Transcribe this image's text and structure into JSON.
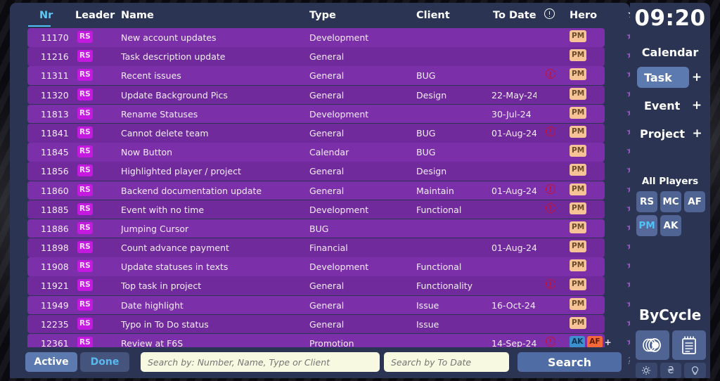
{
  "table": {
    "columns": {
      "nr": "Nr",
      "leader": "Leader",
      "name": "Name",
      "type": "Type",
      "client": "Client",
      "to_date": "To Date",
      "alert": "alert-circle-icon",
      "hero": "Hero",
      "star": "star-icon"
    },
    "sorted_by": "Nr",
    "rows": [
      {
        "nr": "11170",
        "leader": "RS",
        "name": "New account updates",
        "type": "Development",
        "client": "",
        "to_date": "",
        "alert": false,
        "heroes": [
          {
            "code": "PM",
            "style": "pm"
          }
        ],
        "plus": false
      },
      {
        "nr": "11216",
        "leader": "RS",
        "name": "Task description update",
        "type": "General",
        "client": "",
        "to_date": "",
        "alert": false,
        "heroes": [
          {
            "code": "PM",
            "style": "pm"
          }
        ],
        "plus": false
      },
      {
        "nr": "11311",
        "leader": "RS",
        "name": "Recent issues",
        "type": "General",
        "client": "BUG",
        "to_date": "",
        "alert": true,
        "heroes": [
          {
            "code": "PM",
            "style": "pm"
          }
        ],
        "plus": false
      },
      {
        "nr": "11320",
        "leader": "RS",
        "name": "Update Background Pics",
        "type": "General",
        "client": "Design",
        "to_date": "22-May-24",
        "alert": false,
        "heroes": [
          {
            "code": "PM",
            "style": "pm"
          }
        ],
        "plus": false
      },
      {
        "nr": "11813",
        "leader": "RS",
        "name": "Rename Statuses",
        "type": "Development",
        "client": "",
        "to_date": "30-Jul-24",
        "alert": false,
        "heroes": [
          {
            "code": "PM",
            "style": "pm"
          }
        ],
        "plus": false
      },
      {
        "nr": "11841",
        "leader": "RS",
        "name": "Cannot delete team",
        "type": "General",
        "client": "BUG",
        "to_date": "01-Aug-24",
        "alert": true,
        "heroes": [
          {
            "code": "PM",
            "style": "pm"
          }
        ],
        "plus": false
      },
      {
        "nr": "11845",
        "leader": "RS",
        "name": "Now Button",
        "type": "Calendar",
        "client": "BUG",
        "to_date": "",
        "alert": false,
        "heroes": [
          {
            "code": "PM",
            "style": "pm"
          }
        ],
        "plus": false
      },
      {
        "nr": "11856",
        "leader": "RS",
        "name": "Highlighted player / project",
        "type": "General",
        "client": "Design",
        "to_date": "",
        "alert": false,
        "heroes": [
          {
            "code": "PM",
            "style": "pm"
          }
        ],
        "plus": false
      },
      {
        "nr": "11860",
        "leader": "RS",
        "name": "Backend documentation update",
        "type": "General",
        "client": "Maintain",
        "to_date": "01-Aug-24",
        "alert": true,
        "heroes": [
          {
            "code": "PM",
            "style": "pm"
          }
        ],
        "plus": false
      },
      {
        "nr": "11885",
        "leader": "RS",
        "name": "Event with no time",
        "type": "Development",
        "client": "Functional",
        "to_date": "",
        "alert": true,
        "heroes": [
          {
            "code": "PM",
            "style": "pm"
          }
        ],
        "plus": false
      },
      {
        "nr": "11886",
        "leader": "RS",
        "name": "Jumping Cursor",
        "type": "BUG",
        "client": "",
        "to_date": "",
        "alert": false,
        "heroes": [
          {
            "code": "PM",
            "style": "pm"
          }
        ],
        "plus": false
      },
      {
        "nr": "11898",
        "leader": "RS",
        "name": "Count advance payment",
        "type": "Financial",
        "client": "",
        "to_date": "01-Aug-24",
        "alert": false,
        "heroes": [
          {
            "code": "PM",
            "style": "pm"
          }
        ],
        "plus": false
      },
      {
        "nr": "11908",
        "leader": "RS",
        "name": "Update statuses in texts",
        "type": "Development",
        "client": "Functional",
        "to_date": "",
        "alert": false,
        "heroes": [
          {
            "code": "PM",
            "style": "pm"
          }
        ],
        "plus": false
      },
      {
        "nr": "11921",
        "leader": "RS",
        "name": "Top task in project",
        "type": "General",
        "client": "Functionality",
        "to_date": "",
        "alert": true,
        "heroes": [
          {
            "code": "PM",
            "style": "pm"
          }
        ],
        "plus": false
      },
      {
        "nr": "11949",
        "leader": "RS",
        "name": "Date highlight",
        "type": "General",
        "client": "Issue",
        "to_date": "16-Oct-24",
        "alert": false,
        "heroes": [
          {
            "code": "PM",
            "style": "pm"
          }
        ],
        "plus": false
      },
      {
        "nr": "12235",
        "leader": "RS",
        "name": "Typo in To Do status",
        "type": "General",
        "client": "Issue",
        "to_date": "",
        "alert": false,
        "heroes": [
          {
            "code": "PM",
            "style": "pm"
          }
        ],
        "plus": false
      },
      {
        "nr": "12361",
        "leader": "RS",
        "name": "Review at F6S",
        "type": "Promotion",
        "client": "",
        "to_date": "14-Sep-24",
        "alert": true,
        "heroes": [
          {
            "code": "AK",
            "style": "ak"
          },
          {
            "code": "AF",
            "style": "af"
          }
        ],
        "plus": true
      }
    ]
  },
  "toolbar": {
    "active_label": "Active",
    "done_label": "Done",
    "search_placeholder": "Search by: Number, Name, Type or Client",
    "search_value": "",
    "todate_placeholder": "Search by To Date",
    "todate_value": "",
    "search_button": "Search",
    "help_label": "?"
  },
  "sidebar": {
    "clock": "09:20",
    "calendar_label": "Calendar",
    "nav": [
      {
        "label": "Task",
        "plus": "+",
        "active": true
      },
      {
        "label": "Event",
        "plus": "+",
        "active": false
      },
      {
        "label": "Project",
        "plus": "+",
        "active": false
      }
    ],
    "players_label": "All Players",
    "players": [
      {
        "code": "RS",
        "active": false
      },
      {
        "code": "MC",
        "active": false
      },
      {
        "code": "AF",
        "active": false
      },
      {
        "code": "PM",
        "active": true
      },
      {
        "code": "AK",
        "active": false
      }
    ],
    "brand": "ByCycle",
    "tools_big": [
      "cycle-lens-icon",
      "notepad-icon"
    ],
    "tools_small": [
      "gear-icon",
      "hryvnia-currency-icon",
      "lightbulb-icon"
    ]
  },
  "colors": {
    "panel": "#2b3553",
    "row": "#7b2fa8",
    "accent": "#4fc3f7",
    "button": "#5d7ab0",
    "leader_badge": "#c41ae0",
    "hero_pm": "#f5c396",
    "hero_ak": "#3d90cf",
    "hero_af": "#f4683a",
    "alert": "#c0143c"
  }
}
